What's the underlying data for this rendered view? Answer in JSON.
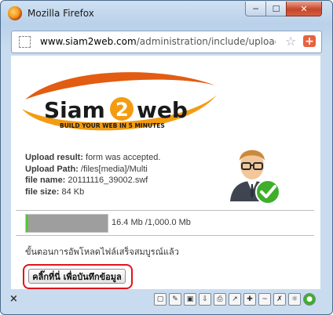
{
  "window": {
    "title": "Mozilla Firefox",
    "controls": {
      "minimize": "─",
      "maximize": "☐",
      "close": "✕"
    }
  },
  "urlbar": {
    "host": "www.siam2web.com",
    "path": "/administration/include/uploadfile.a",
    "bookmark_icon": "star-icon",
    "addon_icon": "plus-icon"
  },
  "logo": {
    "name_left": "Siam",
    "name_digit": "2",
    "name_right": "web",
    "tagline": "BUILD YOUR WEB IN 5 MINUTES",
    "colors": {
      "swoosh": "#f39c12",
      "swoosh_dark": "#e25c12",
      "text": "#1a1a1a"
    }
  },
  "upload": {
    "result_label": "Upload result:",
    "result_value": " form was accepted.",
    "path_label": "Upload Path:",
    "path_value": " /files[media]/Multi",
    "file_name_label": "file name:",
    "file_name_value": " 20111116_39002.swf",
    "file_size_label": "file size:",
    "file_size_value": " 84 Kb"
  },
  "quota": {
    "used_fraction": 1.0,
    "text": "16.4 Mb /1,000.0 Mb",
    "colors": {
      "fill": "#9e9e9e",
      "indicator": "#5bc236"
    }
  },
  "status_message": "ขั้นตอนการอัพโหลดไฟล์เสร็จสมบูรณ์แล้ว",
  "save_button": {
    "label": "คลิ๊กที่นี่ เพื่อบันทึกข้อมูล",
    "highlight_color": "#e0141a"
  },
  "statusbar": {
    "close_glyph": "×",
    "icons": [
      {
        "name": "page-icon",
        "glyph": "▢"
      },
      {
        "name": "pen-icon",
        "glyph": "✎"
      },
      {
        "name": "screenshot-icon",
        "glyph": "▣"
      },
      {
        "name": "download-icon",
        "glyph": "⇩"
      },
      {
        "name": "print-icon",
        "glyph": "⎙"
      },
      {
        "name": "link-icon",
        "glyph": "↗"
      },
      {
        "name": "addon-icon",
        "glyph": "✚"
      },
      {
        "name": "web-icon",
        "glyph": "~"
      },
      {
        "name": "tools-icon",
        "glyph": "✗"
      },
      {
        "name": "settings-icon",
        "glyph": "☼"
      },
      {
        "name": "status-icon",
        "glyph": "●"
      }
    ]
  }
}
